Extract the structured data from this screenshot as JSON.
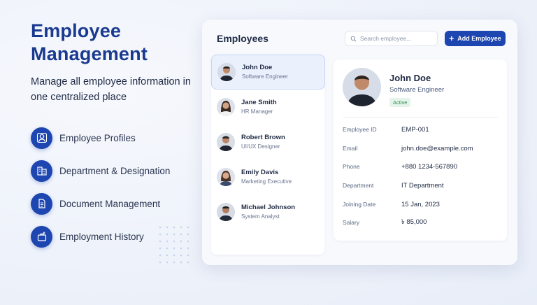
{
  "hero": {
    "title": "Employee Management",
    "subtitle": "Manage all employee information in one centralized place"
  },
  "features": [
    {
      "label": "Employee Profiles",
      "icon": "id-card-icon"
    },
    {
      "label": "Department & Designation",
      "icon": "org-chart-icon"
    },
    {
      "label": "Document Management",
      "icon": "document-icon"
    },
    {
      "label": "Employment History",
      "icon": "history-icon"
    }
  ],
  "panel": {
    "title": "Employees",
    "search_placeholder": "Search employee...",
    "add_label": "Add Employee"
  },
  "employees": [
    {
      "name": "John Doe",
      "role": "Software Engineer"
    },
    {
      "name": "Jane Smith",
      "role": "HR Manager"
    },
    {
      "name": "Robert Brown",
      "role": "UI/UX Designer"
    },
    {
      "name": "Emily Davis",
      "role": "Marketing Executive"
    },
    {
      "name": "Michael Johnson",
      "role": "System Analyst"
    }
  ],
  "detail": {
    "name": "John Doe",
    "role": "Software Engineer",
    "status": "Active",
    "fields": [
      {
        "label": "Employee ID",
        "value": "EMP-001"
      },
      {
        "label": "Email",
        "value": "john.doe@example.com"
      },
      {
        "label": "Phone",
        "value": "+880 1234-567890"
      },
      {
        "label": "Department",
        "value": "IT Department"
      },
      {
        "label": "Joining Date",
        "value": "15 Jan, 2023"
      },
      {
        "label": "Salary",
        "value": "৳ 85,000"
      }
    ]
  },
  "colors": {
    "accent": "#1d46b0",
    "title": "#1a3a8f",
    "status_bg": "#e4f4ea",
    "status_text": "#2f8a4f"
  }
}
